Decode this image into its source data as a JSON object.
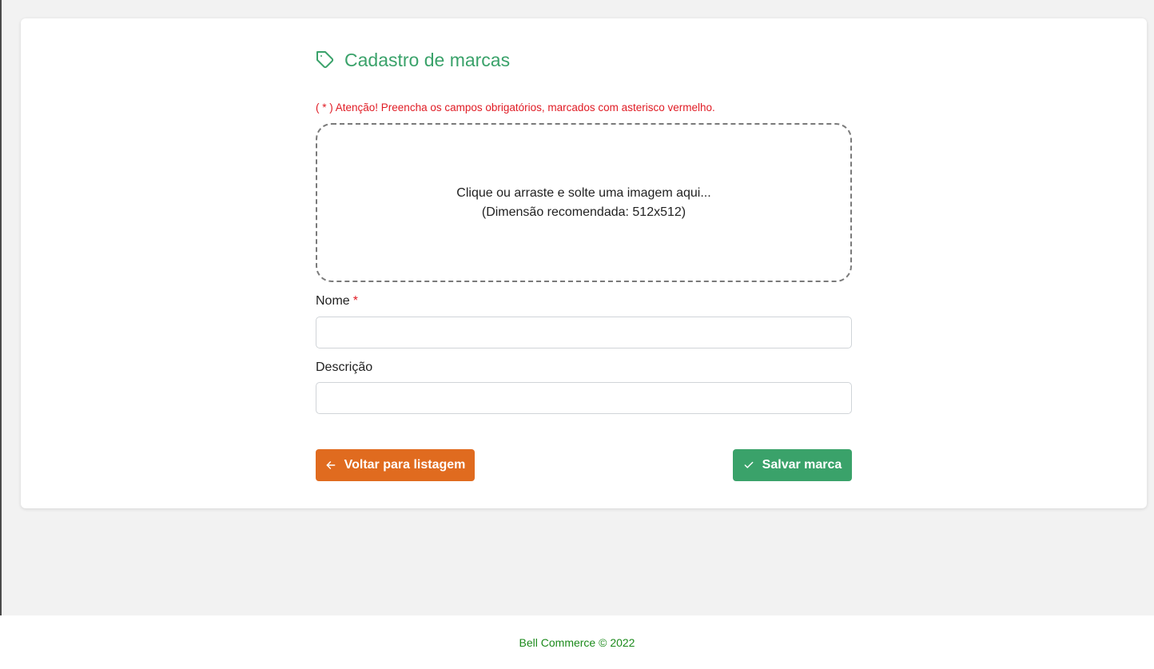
{
  "header": {
    "title": "Cadastro de marcas",
    "title_icon": "tag-icon"
  },
  "form": {
    "warning": "( * ) Atenção! Preencha os campos obrigatórios, marcados com asterisco vermelho.",
    "dropzone": {
      "line1": "Clique ou arraste e solte uma imagem aqui...",
      "line2": "(Dimensão recomendada: 512x512)"
    },
    "fields": {
      "name_label": "Nome",
      "name_required": "*",
      "name_value": "",
      "description_label": "Descrição",
      "description_value": ""
    },
    "buttons": {
      "back_label": "Voltar para listagem",
      "back_icon": "arrow-left-icon",
      "save_label": "Salvar marca",
      "save_icon": "check-icon"
    }
  },
  "footer": {
    "text": "Bell Commerce © 2022"
  },
  "colors": {
    "accent_green": "#3aa26a",
    "back_orange": "#e06b1f",
    "warning_red": "#e01b24",
    "footer_green": "#1b8a1b"
  }
}
